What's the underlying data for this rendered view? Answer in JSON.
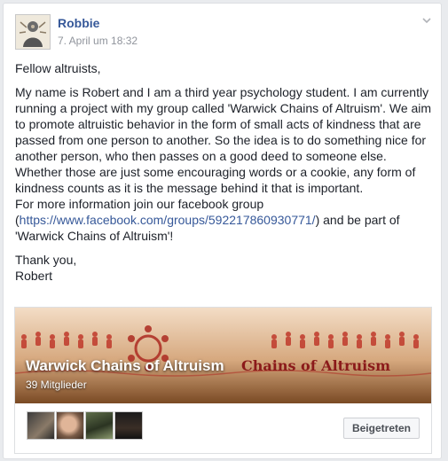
{
  "post": {
    "author": "Robbie",
    "timestamp": "7. April um 18:32",
    "greeting": "Fellow altruists,",
    "paragraph_1": "My name is Robert and I am a third year psychology student. I am currently running a project with my group called 'Warwick Chains of Altruism'. We aim to promote altruistic behavior in the form of small acts of kindness that are passed from one person to another. So the idea is to do something nice for another person, who then passes on a good deed to someone else.",
    "paragraph_2": "Whether those are just some encouraging words or a cookie, any form of kindness counts as it is the message behind it that is important.",
    "paragraph_3_before_link": "For more information join our facebook group (",
    "link": "https://www.facebook.com/groups/592217860930771/",
    "paragraph_3_after_link": ") and be part of 'Warwick Chains of Altruism'!",
    "signoff": "Thank you,",
    "signature": "Robert"
  },
  "group_card": {
    "name": "Warwick Chains of Altruism",
    "member_count": "39 Mitglieder",
    "banner_text": "Chains of Altruism",
    "joined_label": "Beigetreten",
    "member_avatars": [
      "member-photo-1",
      "member-photo-2",
      "member-photo-3",
      "member-photo-4"
    ]
  },
  "icons": {
    "options": "chevron-down-icon"
  },
  "colors": {
    "author_link": "#365899",
    "banner_text": "#8b1a1a",
    "chain_figures": "#c0392b"
  }
}
